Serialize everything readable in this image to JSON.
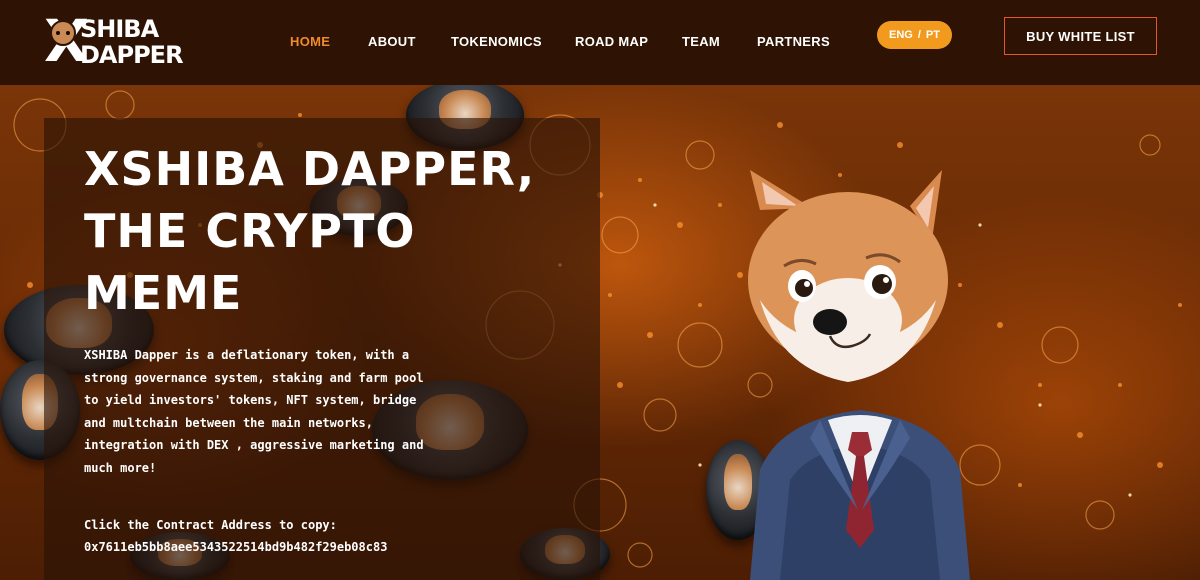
{
  "header": {
    "logo": {
      "line1": "SHIBA",
      "line2": "DAPPER",
      "mark": "X"
    },
    "nav": [
      {
        "label": "HOME",
        "active": true
      },
      {
        "label": "ABOUT",
        "active": false
      },
      {
        "label": "TOKENOMICS",
        "active": false
      },
      {
        "label": "ROAD MAP",
        "active": false
      },
      {
        "label": "TEAM",
        "active": false
      },
      {
        "label": "PARTNERS",
        "active": false
      }
    ],
    "lang": {
      "eng": "ENG",
      "sep": "/",
      "pt": "PT"
    },
    "buy_button": "BUY WHITE LIST"
  },
  "hero": {
    "title_lines": [
      "XSHIBA DAPPER,",
      "THE CRYPTO",
      "MEME"
    ],
    "description_lines": [
      "XSHIBA Dapper is a deflationary token, with a",
      "strong governance system, staking and farm pool",
      "to yield investors' tokens, NFT system, bridge",
      "and multchain between the main networks,",
      "integration with DEX , aggressive marketing and",
      "much more!"
    ],
    "contract_label": "Click the Contract Address to copy:",
    "contract_address": "0x7611eb5bb8aee5343522514bd9b482f29eb08c83"
  },
  "colors": {
    "header_bg": "#2e1304",
    "accent_orange": "#f08a2a",
    "lang_pill": "#f29a1e",
    "buy_border": "#e4572a"
  },
  "icons": [
    "shiba-logo-icon",
    "shiba-coin-icon",
    "shiba-mascot-illustration"
  ]
}
